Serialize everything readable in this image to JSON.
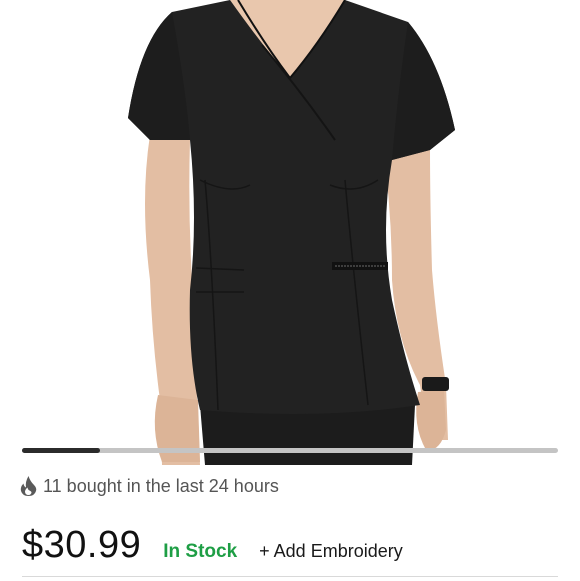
{
  "product": {
    "image_alt": "Black v-neck scrub top",
    "gallery_progress": 0.145
  },
  "social_proof": {
    "icon": "flame-icon",
    "text": "11 bought in the last 24 hours"
  },
  "pricing": {
    "price": "$30.99",
    "stock_status": "In Stock",
    "add_embroidery_label": "+ Add Embroidery"
  },
  "colors": {
    "stock_green": "#1e9e45",
    "gallery_active": "#2b2b2b",
    "gallery_track": "#c4c4c4"
  }
}
